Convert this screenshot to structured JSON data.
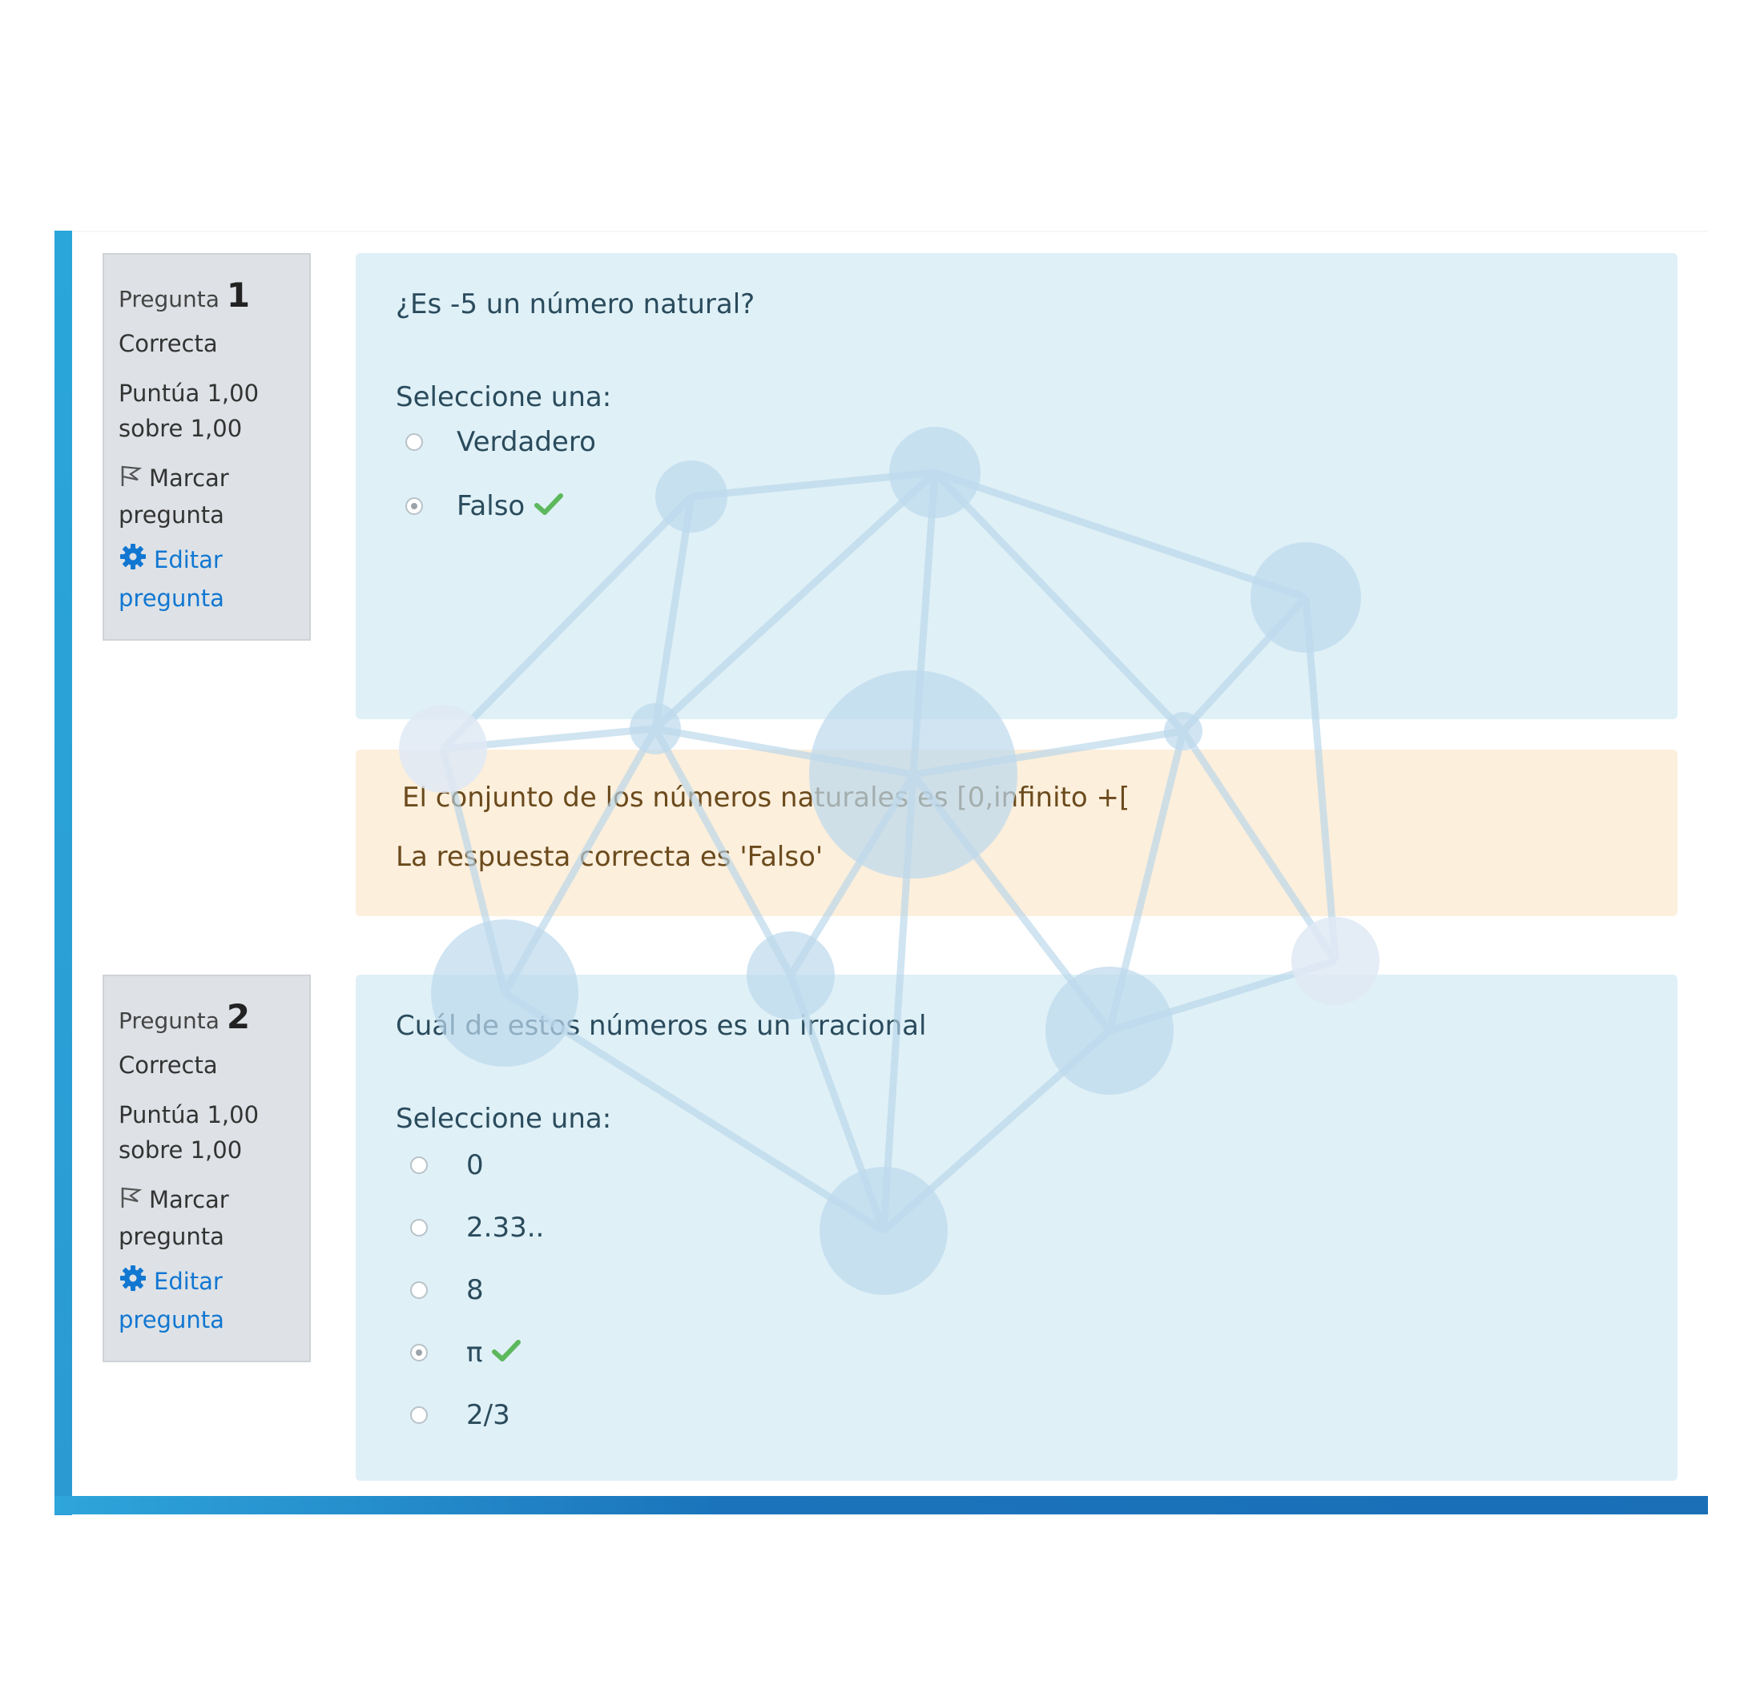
{
  "questions": [
    {
      "label": "Pregunta",
      "number": "1",
      "state": "Correcta",
      "grade_line1": "Puntúa 1,00",
      "grade_line2": "sobre 1,00",
      "flag_line1": "Marcar",
      "flag_line2": "pregunta",
      "edit_line1": "Editar",
      "edit_line2": "pregunta",
      "text": "¿Es -5 un número natural?",
      "prompt": "Seleccione una:",
      "options": [
        {
          "label": "Verdadero",
          "selected": false,
          "correct": false
        },
        {
          "label": "Falso",
          "selected": true,
          "correct": true
        }
      ]
    },
    {
      "label": "Pregunta",
      "number": "2",
      "state": "Correcta",
      "grade_line1": "Puntúa 1,00",
      "grade_line2": "sobre 1,00",
      "flag_line1": "Marcar",
      "flag_line2": "pregunta",
      "edit_line1": "Editar",
      "edit_line2": "pregunta",
      "text": "Cuál de estos números es un irracional",
      "prompt": "Seleccione una:",
      "options": [
        {
          "label": "0",
          "selected": false,
          "correct": false
        },
        {
          "label": "2.33..",
          "selected": false,
          "correct": false
        },
        {
          "label": "8",
          "selected": false,
          "correct": false
        },
        {
          "label": "π",
          "selected": true,
          "correct": true
        },
        {
          "label": "2/3",
          "selected": false,
          "correct": false
        }
      ]
    }
  ],
  "feedback": {
    "general": "El conjunto de los números naturales es [0,infinito +[",
    "right_answer": "La respuesta correcta es 'Falso'"
  },
  "colors": {
    "accent_blue": "#2a9fd6",
    "link_blue": "#1177d1",
    "check_green": "#5cb85c",
    "content_bg": "#dff0f7",
    "feedback_bg": "#fcefdc",
    "info_bg": "#dee2e6"
  },
  "icons": {
    "flag": "flag-icon",
    "gear": "gear-icon",
    "correct": "checkmark-icon"
  }
}
